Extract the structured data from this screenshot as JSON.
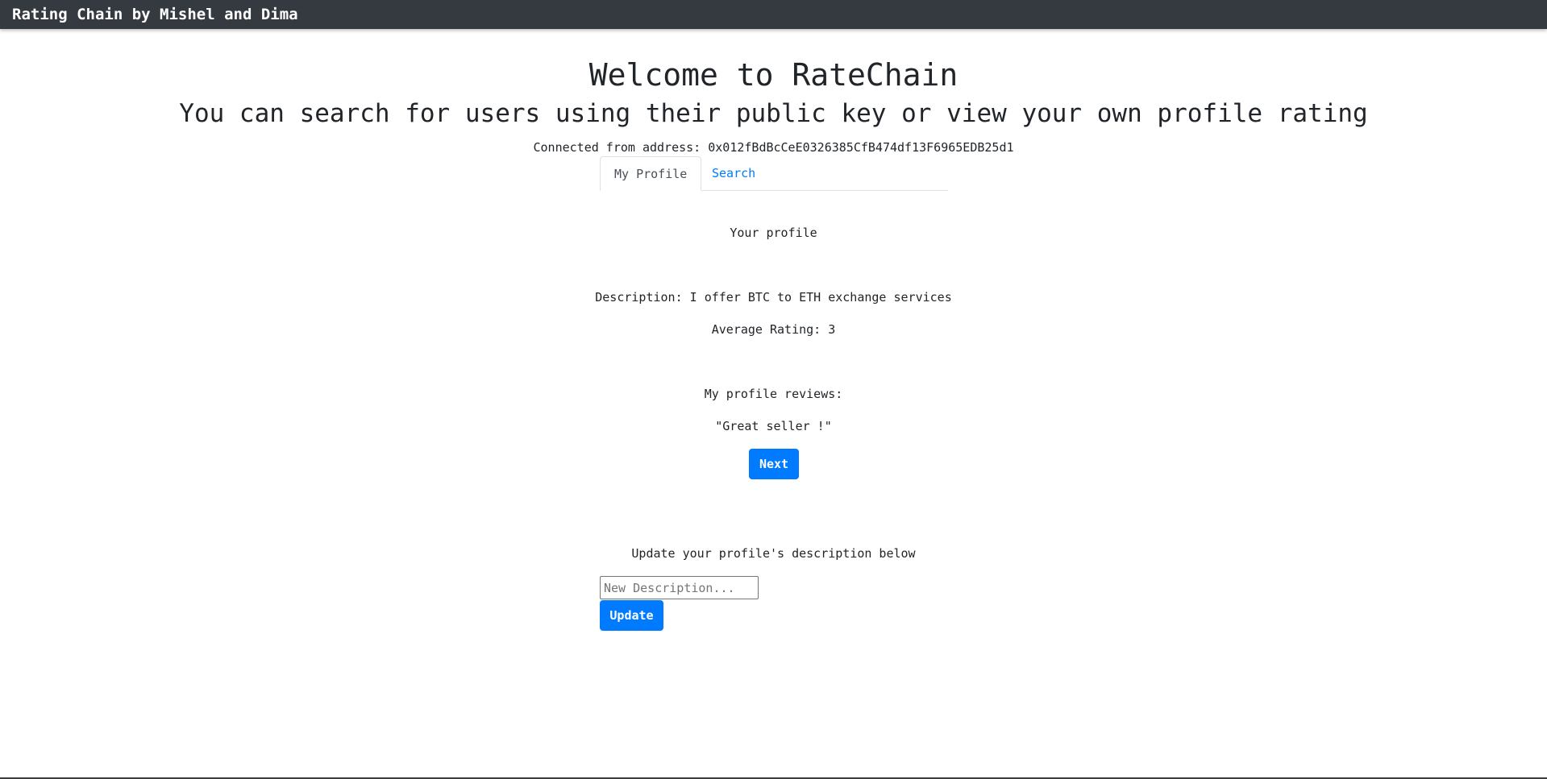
{
  "navbar": {
    "brand": "Rating Chain by Mishel and Dima"
  },
  "header": {
    "title": "Welcome to RateChain",
    "subtitle": "You can search for users using their public key or view your own profile rating",
    "address_text": "Connected from address: 0x012fBdBcCeE0326385CfB474df13F6965EDB25d1"
  },
  "tabs": [
    {
      "label": "My Profile",
      "active": true
    },
    {
      "label": "Search",
      "active": false
    }
  ],
  "profile": {
    "heading": "Your profile",
    "description": "Description: I offer BTC to ETH exchange services",
    "average_rating": "Average Rating: 3",
    "reviews_heading": "My profile reviews:",
    "review_text": "\"Great seller !\"",
    "next_label": "Next"
  },
  "update": {
    "heading": "Update your profile's description below",
    "input_value": "",
    "placeholder": "New Description...",
    "button_label": "Update"
  },
  "colors": {
    "navbar": "#343a40",
    "primary": "#007bff"
  }
}
